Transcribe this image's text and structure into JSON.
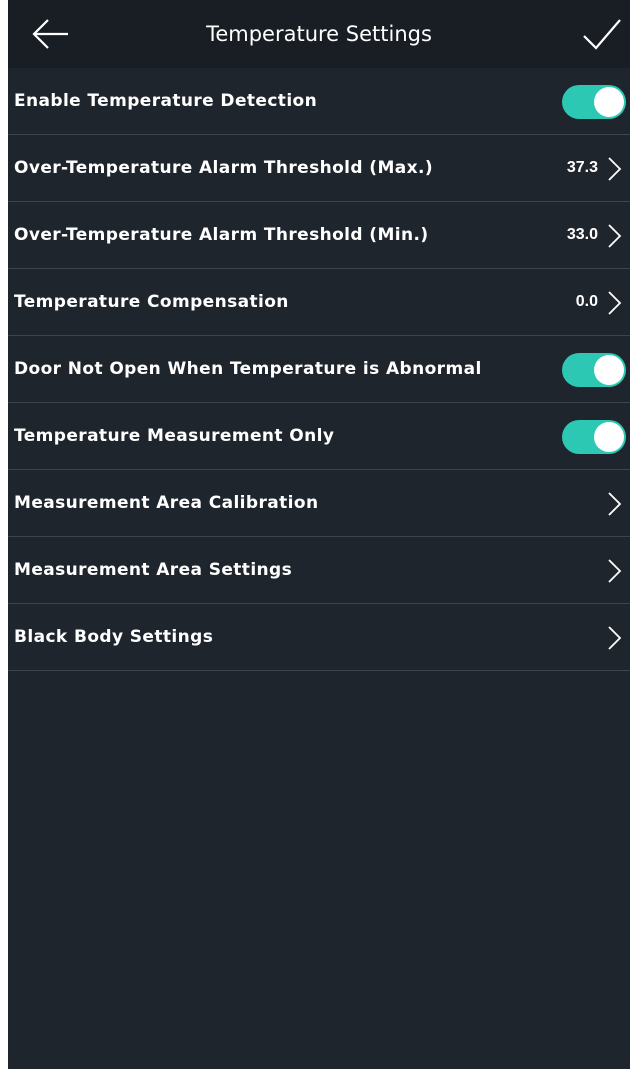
{
  "header": {
    "title": "Temperature Settings",
    "back_icon": "arrow-left-icon",
    "confirm_icon": "checkmark-icon"
  },
  "settings": [
    {
      "label": "Enable Temperature Detection",
      "type": "toggle",
      "enabled": true
    },
    {
      "label": "Over-Temperature Alarm Threshold (Max.)",
      "type": "value",
      "value": "37.3"
    },
    {
      "label": "Over-Temperature Alarm Threshold (Min.)",
      "type": "value",
      "value": "33.0"
    },
    {
      "label": "Temperature Compensation",
      "type": "value",
      "value": "0.0"
    },
    {
      "label": "Door Not Open When Temperature is Abnormal",
      "type": "toggle",
      "enabled": true
    },
    {
      "label": "Temperature Measurement Only",
      "type": "toggle",
      "enabled": true
    },
    {
      "label": "Measurement Area Calibration",
      "type": "link"
    },
    {
      "label": "Measurement Area Settings",
      "type": "link"
    },
    {
      "label": "Black Body Settings",
      "type": "link"
    }
  ],
  "colors": {
    "background": "#1f252c",
    "header": "#191e25",
    "toggle_on": "#2cc8b4",
    "divider": "#3d444c",
    "text": "#ffffff"
  }
}
